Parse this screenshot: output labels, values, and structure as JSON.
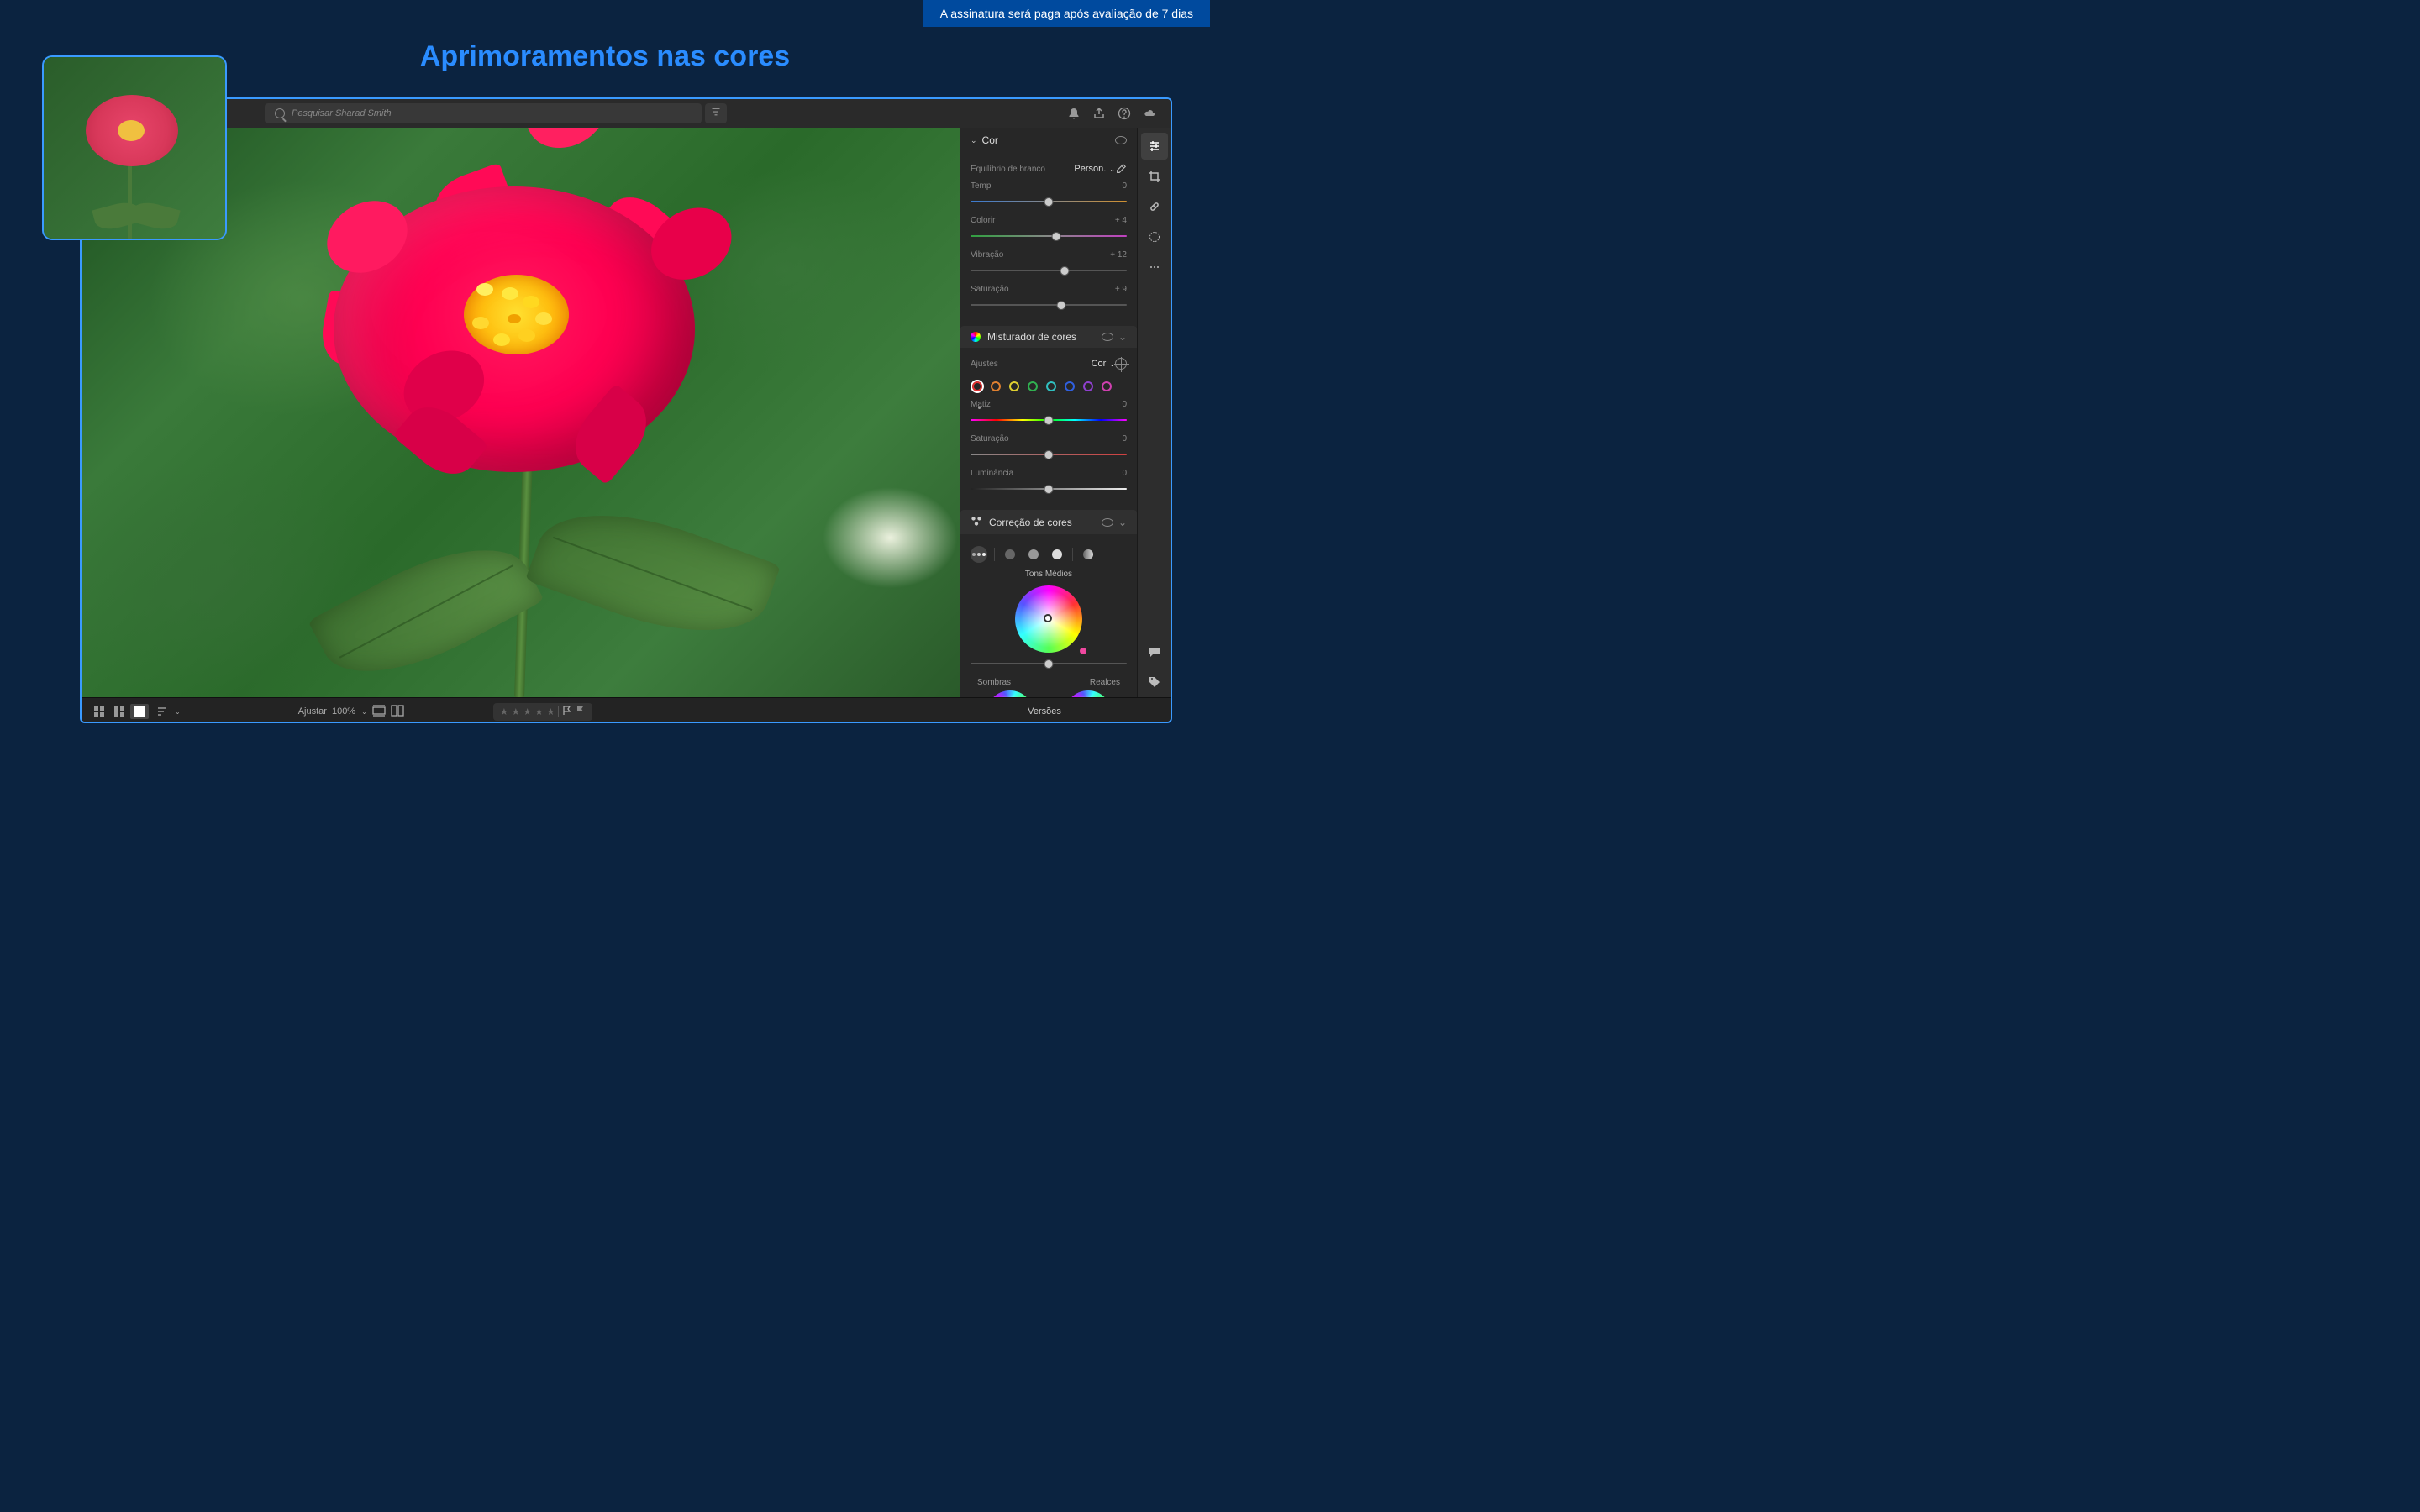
{
  "banner": "A assinatura será paga após avaliação de 7 dias",
  "title": "Aprimoramentos nas cores",
  "search": {
    "placeholder": "Pesquisar Sharad Smith"
  },
  "color_panel": {
    "title": "Cor",
    "wb_label": "Equilíbrio de branco",
    "wb_value": "Person.",
    "sliders": [
      {
        "label": "Temp",
        "value": "0",
        "pos": 50,
        "track": "track-temp"
      },
      {
        "label": "Colorir",
        "value": "+ 4",
        "pos": 55,
        "track": "track-tint"
      },
      {
        "label": "Vibração",
        "value": "+ 12",
        "pos": 60,
        "track": ""
      },
      {
        "label": "Saturação",
        "value": "+ 9",
        "pos": 58,
        "track": ""
      }
    ]
  },
  "mixer": {
    "title": "Misturador de cores",
    "adjust_label": "Ajustes",
    "adjust_value": "Cor",
    "colors": [
      "#e03030",
      "#e08030",
      "#e0d030",
      "#30b050",
      "#30c0c0",
      "#3060e0",
      "#9040d0",
      "#d040b0"
    ],
    "sliders": [
      {
        "label": "Matiz",
        "value": "0",
        "pos": 50,
        "track": "track-hue"
      },
      {
        "label": "Saturação",
        "value": "0",
        "pos": 50,
        "track": "track-sat"
      },
      {
        "label": "Luminância",
        "value": "0",
        "pos": 50,
        "track": "track-lum"
      }
    ]
  },
  "grading": {
    "title": "Correção de cores",
    "midtones": "Tons Médios",
    "shadows": "Sombras",
    "highlights": "Realces"
  },
  "bottom": {
    "fit": "Ajustar",
    "zoom": "100%",
    "versions": "Versões"
  }
}
